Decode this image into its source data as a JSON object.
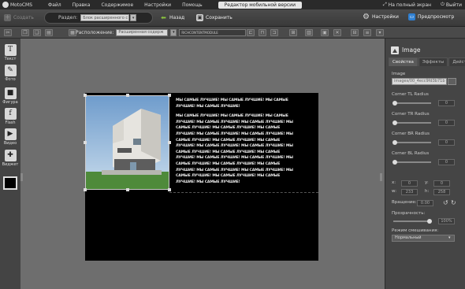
{
  "menubar": {
    "app_name": "MotoCMS",
    "items": [
      "Файл",
      "Правка",
      "Содержимое",
      "Настройки",
      "Помощь"
    ],
    "active_tab": "Редактор мобильной версии",
    "fullscreen": "На полный экран",
    "exit": "Выйти"
  },
  "toolbar": {
    "create": "Создать",
    "section_label": "Раздел:",
    "section_value": "Блок расширенного с",
    "back": "Назад",
    "save": "Сохранить",
    "settings": "Настройки",
    "preview": "Предпросмотр"
  },
  "subtoolbar": {
    "layout_label": "Расположение:",
    "layout_value": "Расширенная содерж",
    "module_value": "RICHCONTENTMODULE"
  },
  "tools": [
    {
      "label": "Текст",
      "glyph": "T"
    },
    {
      "label": "Фото",
      "glyph": "✎"
    },
    {
      "label": "Фигура",
      "glyph": "■"
    },
    {
      "label": "Flash",
      "glyph": "f"
    },
    {
      "label": "Видео",
      "glyph": "▶"
    },
    {
      "label": "Виджет",
      "glyph": "✚"
    }
  ],
  "content": {
    "text_p1": "МЫ САМЫЕ ЛУЧШИЕ! МЫ САМЫЕ ЛУЧШИЕ! МЫ САМЫЕ ЛУЧШИЕ! МЫ САМЫЕ ЛУЧШИЕ!",
    "text_p2": "МЫ САМЫЕ ЛУЧШИЕ! МЫ САМЫЕ ЛУЧШИЕ! МЫ САМЫЕ ЛУЧШИЕ! МЫ САМЫЕ ЛУЧШИЕ! МЫ САМЫЕ ЛУЧШИЕ! МЫ САМЫЕ ЛУЧШИЕ! МЫ САМЫЕ ЛУЧШИЕ! МЫ САМЫЕ ЛУЧШИЕ! МЫ САМЫЕ ЛУЧШИЕ! МЫ САМЫЕ ЛУЧШИЕ! МЫ САМЫЕ ЛУЧШИЕ! МЫ САМЫЕ ЛУЧШИЕ! МЫ САМЫЕ ЛУЧШИЕ! МЫ САМЫЕ ЛУЧШИЕ! МЫ САМЫЕ ЛУЧШИЕ! МЫ САМЫЕ ЛУЧШИЕ! МЫ САМЫЕ ЛУЧШИЕ! МЫ САМЫЕ ЛУЧШИЕ! МЫ САМЫЕ ЛУЧШИЕ! МЫ САМЫЕ ЛУЧШИЕ! МЫ САМЫЕ ЛУЧШИЕ! МЫ САМЫЕ ЛУЧШИЕ! МЫ САМЫЕ ЛУЧШИЕ! МЫ САМЫЕ ЛУЧШИЕ! МЫ САМЫЕ ЛУЧШИЕ! МЫ САМЫЕ ЛУЧШИЕ! МЫ САМЫЕ ЛУЧШИЕ! МЫ САМЫЕ ЛУЧШИЕ! МЫ САМЫЕ ЛУЧШИЕ!"
  },
  "panel": {
    "title": "Image",
    "tabs": [
      "Свойства",
      "Эффекты",
      "Действия"
    ],
    "image_label": "Image",
    "image_path": "images/00_4ecc9fd3b71b",
    "corner_tl_label": "Corner TL Radius",
    "corner_tl_value": "0",
    "corner_tr_label": "Corner TR Radius",
    "corner_tr_value": "0",
    "corner_br_label": "Corner BR Radius",
    "corner_br_value": "0",
    "corner_bl_label": "Corner BL Radius",
    "corner_bl_value": "0",
    "x_label": "x:",
    "x_value": "0",
    "y_label": "y:",
    "y_value": "0",
    "w_label": "w:",
    "w_value": "233",
    "h_label": "h:",
    "h_value": "258",
    "rotation_label": "Вращение:",
    "rotation_value": "0.00",
    "opacity_label": "Прозрачность:",
    "opacity_value": "100%",
    "blend_label": "Режим смешивания:",
    "blend_value": "Нормальный"
  },
  "colors": {
    "accent_green": "#8cc63f",
    "page_bg": "#000000",
    "panel_bg": "#454545"
  }
}
